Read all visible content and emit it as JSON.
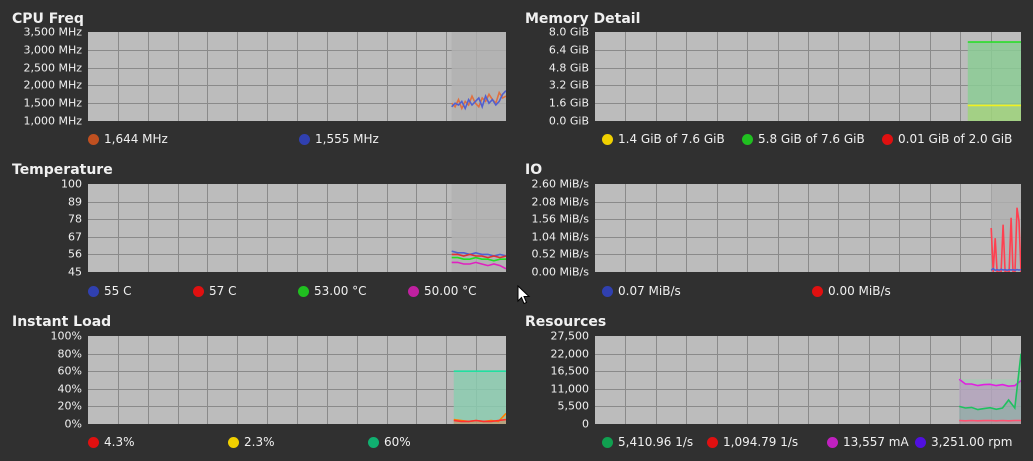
{
  "panels": [
    {
      "id": "cpu-freq",
      "title": "CPU Freq",
      "yticks": [
        "3,500 MHz",
        "3,000 MHz",
        "2,500 MHz",
        "2,000 MHz",
        "1,500 MHz",
        "1,000 MHz"
      ],
      "legend": [
        {
          "label": "1,644 MHz",
          "color": "#c05020"
        },
        {
          "label": "1,555 MHz",
          "color": "#3040b0"
        }
      ],
      "chart_data": {
        "type": "line",
        "ylim": [
          1000,
          3500
        ],
        "series": [
          {
            "color": "#e07040",
            "values": [
              1500,
              1400,
              1600,
              1350,
              1550,
              1450,
              1700,
              1500,
              1400,
              1650,
              1550,
              1750,
              1600,
              1500,
              1800,
              1650,
              1700
            ]
          },
          {
            "color": "#5060d0",
            "values": [
              1400,
              1500,
              1450,
              1550,
              1350,
              1600,
              1450,
              1550,
              1650,
              1400,
              1700,
              1500,
              1600,
              1450,
              1550,
              1750,
              1850
            ]
          }
        ]
      }
    },
    {
      "id": "memory-detail",
      "title": "Memory Detail",
      "yticks": [
        "8.0 GiB",
        "6.4 GiB",
        "4.8 GiB",
        "3.2 GiB",
        "1.6 GiB",
        "0.0 GiB"
      ],
      "legend": [
        {
          "label": "1.4 GiB of 7.6 GiB",
          "color": "#f0d000"
        },
        {
          "label": "5.8 GiB of 7.6 GiB",
          "color": "#20c020"
        },
        {
          "label": "0.01 GiB of 2.0 GiB",
          "color": "#e01010"
        }
      ],
      "chart_data": {
        "type": "area",
        "ylim": [
          0,
          8
        ],
        "series": [
          {
            "color": "#20e020",
            "values": [
              7.1,
              7.1,
              7.1,
              7.1,
              7.1,
              7.1,
              7.1,
              7.1,
              7.1,
              7.1
            ]
          },
          {
            "color": "#f0f020",
            "values": [
              1.4,
              1.4,
              1.4,
              1.4,
              1.4,
              1.4,
              1.4,
              1.4,
              1.4,
              1.4
            ]
          }
        ]
      }
    },
    {
      "id": "temperature",
      "title": "Temperature",
      "yticks": [
        "100",
        "89",
        "78",
        "67",
        "56",
        "45"
      ],
      "legend": [
        {
          "label": "55 C",
          "color": "#3040b0"
        },
        {
          "label": "57 C",
          "color": "#e01010"
        },
        {
          "label": "53.00 °C",
          "color": "#20c020"
        },
        {
          "label": "50.00 °C",
          "color": "#c020a0"
        }
      ],
      "chart_data": {
        "type": "line",
        "ylim": [
          45,
          100
        ],
        "series": [
          {
            "color": "#5060d0",
            "values": [
              58,
              57,
              57,
              56,
              57,
              56,
              56,
              55,
              56,
              55
            ]
          },
          {
            "color": "#e03030",
            "values": [
              56,
              56,
              55,
              56,
              55,
              55,
              54,
              55,
              54,
              55
            ]
          },
          {
            "color": "#20e020",
            "values": [
              54,
              54,
              53,
              53,
              54,
              53,
              53,
              52,
              53,
              53
            ]
          },
          {
            "color": "#e020c0",
            "values": [
              51,
              51,
              50,
              50,
              51,
              50,
              49,
              50,
              49,
              47
            ]
          }
        ]
      }
    },
    {
      "id": "io",
      "title": "IO",
      "yticks": [
        "2.60 MiB/s",
        "2.08 MiB/s",
        "1.56 MiB/s",
        "1.04 MiB/s",
        "0.52 MiB/s",
        "0.00 MiB/s"
      ],
      "legend": [
        {
          "label": "0.07 MiB/s",
          "color": "#3040b0"
        },
        {
          "label": "0.00 MiB/s",
          "color": "#e01010"
        }
      ],
      "chart_data": {
        "type": "line",
        "ylim": [
          0,
          2.6
        ],
        "series": [
          {
            "color": "#ff4050",
            "values": [
              1.3,
              0,
              1.0,
              0,
              0,
              0,
              1.4,
              0,
              0,
              0,
              1.6,
              0,
              0,
              1.9,
              1.5,
              0
            ]
          },
          {
            "color": "#5060d0",
            "values": [
              0.05,
              0.1,
              0.05,
              0.07,
              0.05,
              0.08,
              0.06,
              0.07,
              0.05,
              0.07,
              0.06,
              0.07,
              0.05,
              0.07,
              0.06,
              0.07
            ]
          }
        ]
      }
    },
    {
      "id": "instant-load",
      "title": "Instant Load",
      "yticks": [
        "100%",
        "80%",
        "60%",
        "40%",
        "20%",
        "0%"
      ],
      "legend": [
        {
          "label": "4.3%",
          "color": "#e01010"
        },
        {
          "label": "2.3%",
          "color": "#f0d000"
        },
        {
          "label": "60%",
          "color": "#10b070"
        }
      ],
      "chart_data": {
        "type": "area",
        "ylim": [
          0,
          100
        ],
        "series": [
          {
            "color": "#20e0a0",
            "values": [
              60,
              60,
              60,
              60,
              60,
              60,
              60,
              60
            ]
          },
          {
            "color": "#ff8000",
            "values": [
              5,
              4,
              3,
              4,
              3,
              4,
              3,
              12
            ]
          },
          {
            "color": "#ff3030",
            "values": [
              4,
              3,
              3,
              4,
              3,
              3,
              4,
              5
            ]
          }
        ]
      }
    },
    {
      "id": "resources",
      "title": "Resources",
      "yticks": [
        "27,500",
        "22,000",
        "16,500",
        "11,000",
        "5,500",
        "0"
      ],
      "legend": [
        {
          "label": "5,410.96 1/s",
          "color": "#10a050"
        },
        {
          "label": "1,094.79 1/s",
          "color": "#e01010"
        },
        {
          "label": "13,557 mA",
          "color": "#c020c0"
        },
        {
          "label": "3,251.00 rpm",
          "color": "#5010e0"
        }
      ],
      "chart_data": {
        "type": "area",
        "ylim": [
          0,
          27500
        ],
        "series": [
          {
            "color": "#e020e0",
            "values": [
              14000,
              12500,
              12500,
              12000,
              12300,
              12400,
              12000,
              12300,
              11800,
              12000,
              13557
            ]
          },
          {
            "color": "#20c060",
            "values": [
              5500,
              5000,
              5200,
              4500,
              4800,
              5100,
              4600,
              5000,
              7500,
              5000,
              22000
            ]
          },
          {
            "color": "#ff5070",
            "values": [
              1100,
              1000,
              1100,
              1000,
              1050,
              1100,
              1000,
              1090,
              1000,
              1100,
              1095
            ]
          }
        ]
      }
    }
  ]
}
